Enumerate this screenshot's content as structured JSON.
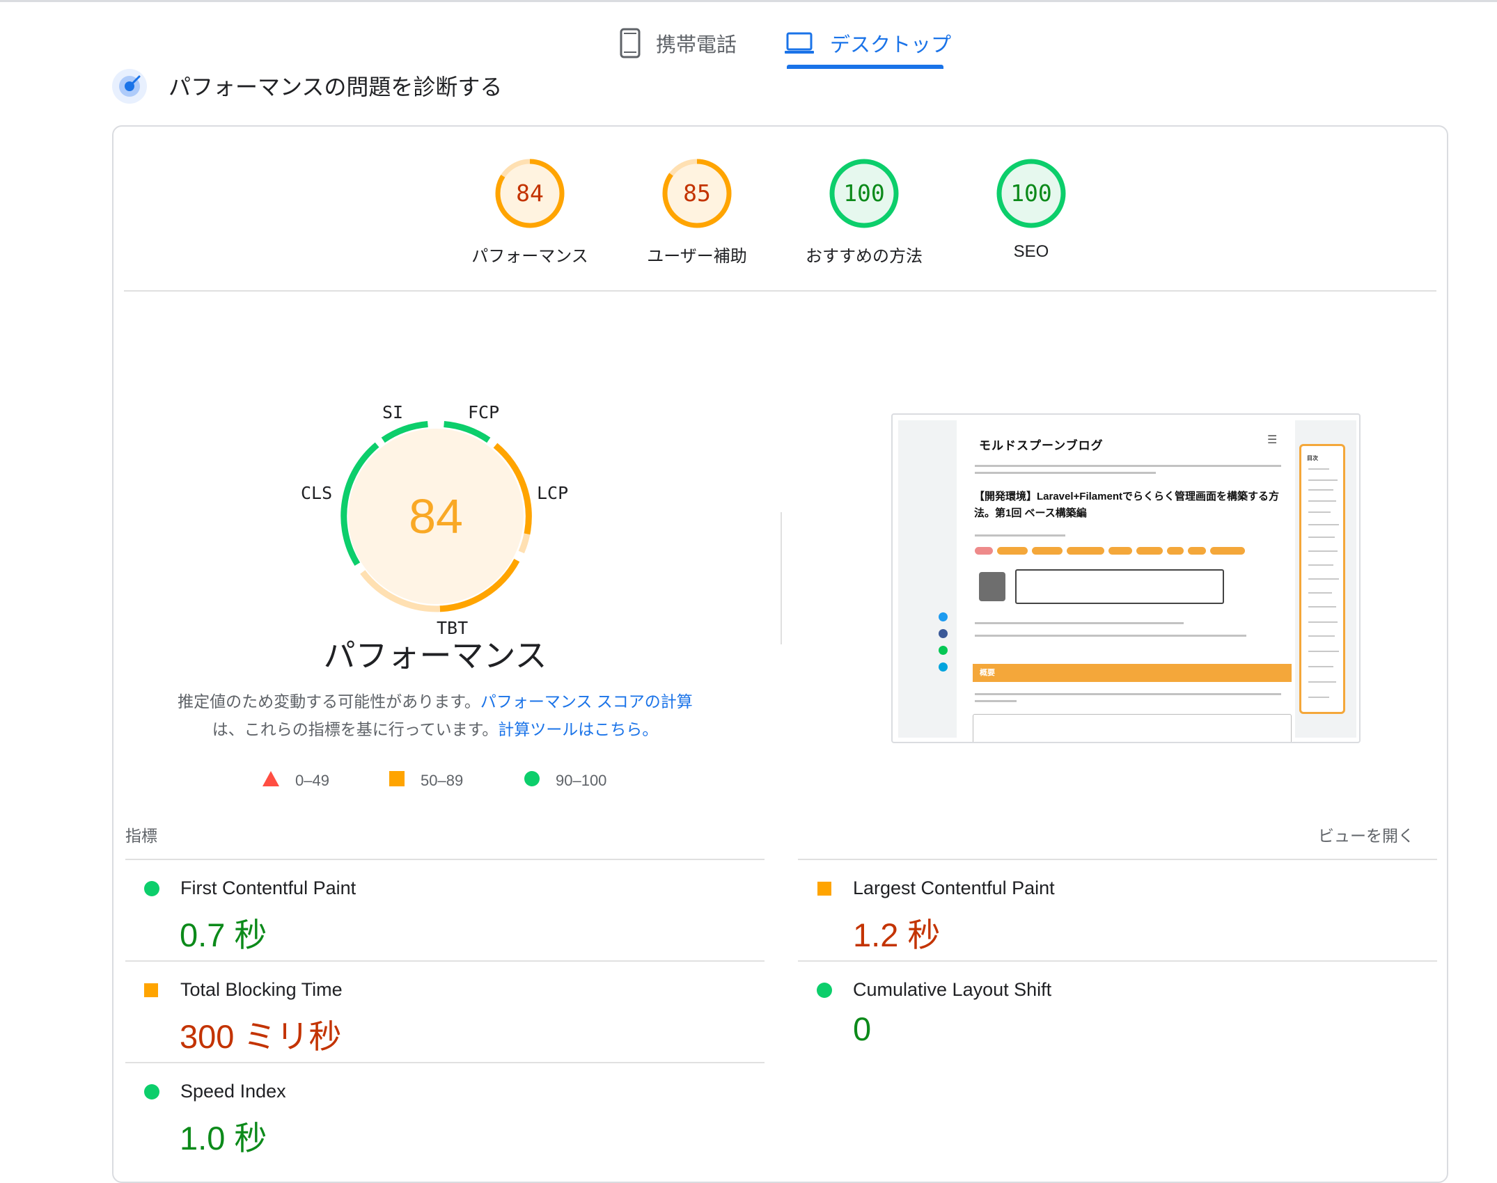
{
  "device_tabs": {
    "mobile_label": "携帯電話",
    "desktop_label": "デスクトップ",
    "selected": "desktop"
  },
  "diagnose": {
    "title": "パフォーマンスの問題を診断する"
  },
  "categories": [
    {
      "score": "84",
      "label": "パフォーマンス",
      "rating": "average"
    },
    {
      "score": "85",
      "label": "ユーザー補助",
      "rating": "average"
    },
    {
      "score": "100",
      "label": "おすすめの方法",
      "rating": "good"
    },
    {
      "score": "100",
      "label": "SEO",
      "rating": "good"
    }
  ],
  "performance": {
    "score": "84",
    "title": "パフォーマンス",
    "gauge_labels": {
      "si": "SI",
      "fcp": "FCP",
      "lcp": "LCP",
      "tbt": "TBT",
      "cls": "CLS"
    },
    "note_pre": "推定値のため変動する可能性があります。",
    "note_link1": "パフォーマンス スコアの計算",
    "note_mid": "は、これらの指標を基に行っています。",
    "note_link2": "計算ツールはこちら。"
  },
  "legend": [
    {
      "range": "0–49",
      "shape": "triangle",
      "color": "#ff4e42"
    },
    {
      "range": "50–89",
      "shape": "square",
      "color": "#ffa400"
    },
    {
      "range": "90–100",
      "shape": "circle",
      "color": "#0cce6b"
    }
  ],
  "screenshot": {
    "site_title": "モルドスプーンブログ",
    "article_title": "【開発環境】Laravel+Filamentでらくらく管理画面を構築する方法。第1回 ベース構築編",
    "toc_heading": "目次",
    "section_heading": "概要"
  },
  "metrics_section": {
    "label": "指標",
    "view_toggle": "ビューを開く",
    "items": [
      {
        "name": "First Contentful Paint",
        "value": "0.7 秒",
        "rating": "good"
      },
      {
        "name": "Largest Contentful Paint",
        "value": "1.2 秒",
        "rating": "average"
      },
      {
        "name": "Total Blocking Time",
        "value": "300 ミリ秒",
        "rating": "average"
      },
      {
        "name": "Cumulative Layout Shift",
        "value": "0",
        "rating": "good"
      },
      {
        "name": "Speed Index",
        "value": "1.0 秒",
        "rating": "good"
      }
    ]
  },
  "colors": {
    "good": "#0cce6b",
    "average": "#ffa400",
    "poor": "#ff4e42",
    "good_text": "#0c8a1a",
    "average_text": "#c33300",
    "accent": "#1a73e8"
  }
}
